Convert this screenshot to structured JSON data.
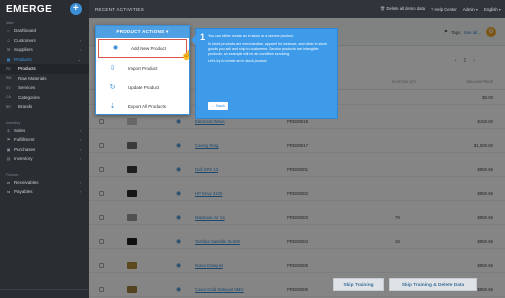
{
  "sidebar": {
    "brand": "EMERGE",
    "plus": "+",
    "section_main": "Main",
    "items_top": [
      {
        "icon": "⌂",
        "label": "Dashboard"
      },
      {
        "icon": "☺",
        "label": "Customers"
      },
      {
        "icon": "⚒",
        "label": "Suppliers"
      },
      {
        "icon": "▦",
        "label": "Products"
      }
    ],
    "sub_items": [
      {
        "abbr": "PD",
        "label": "Products"
      },
      {
        "abbr": "RM",
        "label": "Raw Materials"
      },
      {
        "abbr": "SV",
        "label": "Services"
      },
      {
        "abbr": "CA",
        "label": "Categories"
      },
      {
        "abbr": "BR",
        "label": "Brands"
      }
    ],
    "section_2": "Inventory",
    "items_mid": [
      {
        "icon": "$",
        "label": "Sales"
      },
      {
        "icon": "⚑",
        "label": "Fulfillment"
      },
      {
        "icon": "▣",
        "label": "Purchases"
      },
      {
        "icon": "▤",
        "label": "Inventory"
      }
    ],
    "section_3": "Finance",
    "items_bottom": [
      {
        "icon": "⇄",
        "label": "Receivables"
      },
      {
        "icon": "⇆",
        "label": "Payables"
      }
    ]
  },
  "topbar": {
    "recent": "RECENT ACTIVITIES",
    "delete_all": "Delete all demo data",
    "help": "Help Center",
    "user": "Admin",
    "lang": "English"
  },
  "toolbar": {
    "tags": "Tags",
    "see_all": "See all..."
  },
  "pager": {
    "prev": "‹",
    "page": "1",
    "next": "›"
  },
  "table": {
    "headers": {
      "qty": "IN STOCK QTY",
      "price": "SELLING PRICE"
    },
    "rows": [
      {
        "name": "",
        "sku": "",
        "qty": "",
        "price": "$0.00",
        "color": "#bbbbbb"
      },
      {
        "name": "Electrical Wires",
        "sku": "PRD00018",
        "qty": "",
        "price": "$150.60",
        "color": "#c8c8c8"
      },
      {
        "name": "Casing Ring",
        "sku": "PRD00017",
        "qty": "",
        "price": "$1,000.60",
        "color": "#6f6f6f"
      },
      {
        "name": "Dell XPS 13",
        "sku": "PRD00001",
        "qty": "",
        "price": "$850.65",
        "color": "#3a3a3a"
      },
      {
        "name": "HP Envy 3100",
        "sku": "PRD00002",
        "qty": "",
        "price": "$850.65",
        "color": "#2b2b2b"
      },
      {
        "name": "Macbook Air 13",
        "sku": "PRD00003",
        "qty": "79",
        "price": "$850.65",
        "color": "#9a9a9a"
      },
      {
        "name": "Toshiba Satellite SL500",
        "sku": "PRD00004",
        "qty": "19",
        "price": "$850.65",
        "color": "#1e1e1e"
      },
      {
        "name": "Rolex Datejust",
        "sku": "PRD00005",
        "qty": "",
        "price": "$850.65",
        "color": "#b08d3a"
      },
      {
        "name": "Casio Gold Datejust 5MG",
        "sku": "PRD00006",
        "qty": "",
        "price": "$850.65",
        "color": "#a08040"
      }
    ]
  },
  "menu": {
    "header": "PRODUCT ACTIONS ▾",
    "items": [
      {
        "icon": "✹",
        "label": "Add New Product"
      },
      {
        "icon": "⇩",
        "label": "Import Product"
      },
      {
        "icon": "↻",
        "label": "Update Product"
      },
      {
        "icon": "⇣",
        "label": "Export All Products"
      }
    ]
  },
  "tip": {
    "number": "1",
    "p1": "You can either create an in stock or a service product.",
    "p2": "In stock products are merchandise, apparel for instance, and other in stock goods you sell and ship to customers. Service products are intangible products, an example will be air-condition servicing.",
    "p3": "Let's try to create an in stock product",
    "back": "← Back"
  },
  "buttons": {
    "skip": "Skip Training",
    "skip_delete": "Skip Training & Delete Data"
  }
}
